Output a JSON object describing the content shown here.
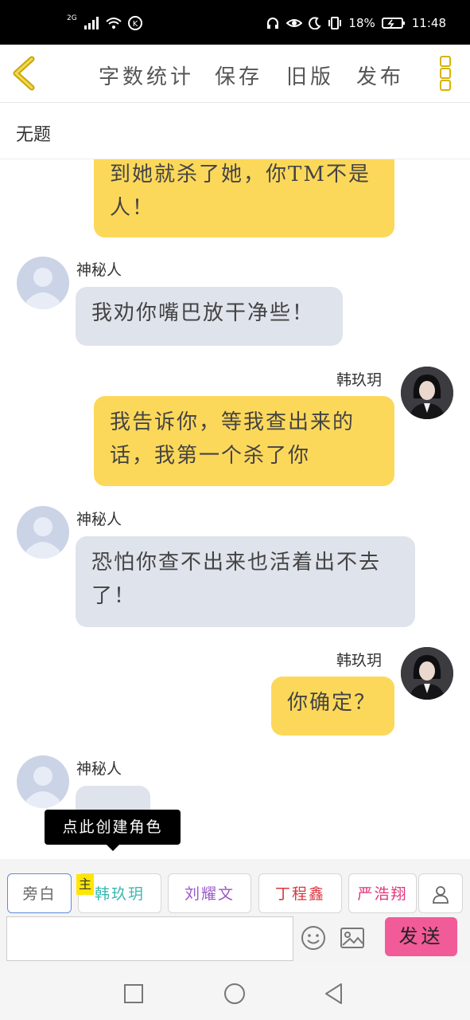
{
  "status_bar": {
    "network": "2G",
    "battery": "18%",
    "time": "11:48"
  },
  "toolbar": {
    "word_count": "字数统计",
    "save": "保存",
    "old_version": "旧版",
    "publish": "发布"
  },
  "title": "无题",
  "messages": [
    {
      "side": "me",
      "name": "",
      "text": "到她就杀了她，你TM不是人！"
    },
    {
      "side": "other",
      "name": "神秘人",
      "text": "我劝你嘴巴放干净些！"
    },
    {
      "side": "me",
      "name": "韩玖玥",
      "text": "我告诉你，等我查出来的话，我第一个杀了你"
    },
    {
      "side": "other",
      "name": "神秘人",
      "text": "恐怕你查不出来也活着出不去了！"
    },
    {
      "side": "me",
      "name": "韩玖玥",
      "text": "你确定？"
    },
    {
      "side": "other",
      "name": "神秘人",
      "text": "…"
    }
  ],
  "tooltip": "点此创建角色",
  "roles": [
    {
      "label": "旁白",
      "color": "#666666"
    },
    {
      "label": "韩玖玥",
      "color": "#3bb8b0",
      "badge": "主"
    },
    {
      "label": "刘耀文",
      "color": "#9b59c9"
    },
    {
      "label": "丁程鑫",
      "color": "#d9363e"
    },
    {
      "label": "严浩翔",
      "color": "#e0357a"
    }
  ],
  "input": {
    "placeholder": "",
    "send": "发送"
  },
  "colors": {
    "accent_yellow": "#fcd85a",
    "bubble_grey": "#dfe3ec",
    "send_pink": "#f15b98"
  }
}
